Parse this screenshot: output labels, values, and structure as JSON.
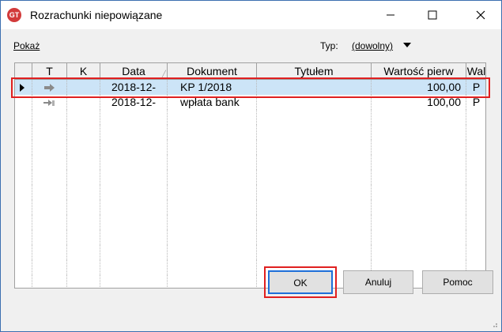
{
  "window": {
    "title": "Rozrachunki niepowiązane",
    "icon_label": "GT",
    "controls": [
      "minimize-icon",
      "maximize-icon",
      "close-icon"
    ]
  },
  "toolbar": {
    "show_label": "Pokaż",
    "type_label": "Typ:",
    "type_value": "(dowolny)"
  },
  "grid": {
    "columns": [
      "T",
      "K",
      "Data",
      "Dokument",
      "Tytułem",
      "Wartość pierw",
      "Wal"
    ],
    "rows": [
      {
        "selected": true,
        "t_icon": "arrow-right-icon",
        "k": "",
        "data": "2018-12-",
        "dokument": "KP 1/2018",
        "tytulem": "",
        "wartosc": "100,00",
        "wal": "P"
      },
      {
        "selected": false,
        "t_icon": "arrow-bar-icon",
        "k": "",
        "data": "2018-12-",
        "dokument": "wpłata bank",
        "tytulem": "",
        "wartosc": "100,00",
        "wal": "P"
      }
    ]
  },
  "buttons": {
    "ok": "OK",
    "cancel": "Anuluj",
    "help": "Pomoc"
  },
  "colors": {
    "selection": "#cce4f7",
    "highlight_outline": "#e02020",
    "focus_border": "#1e6fd9"
  }
}
